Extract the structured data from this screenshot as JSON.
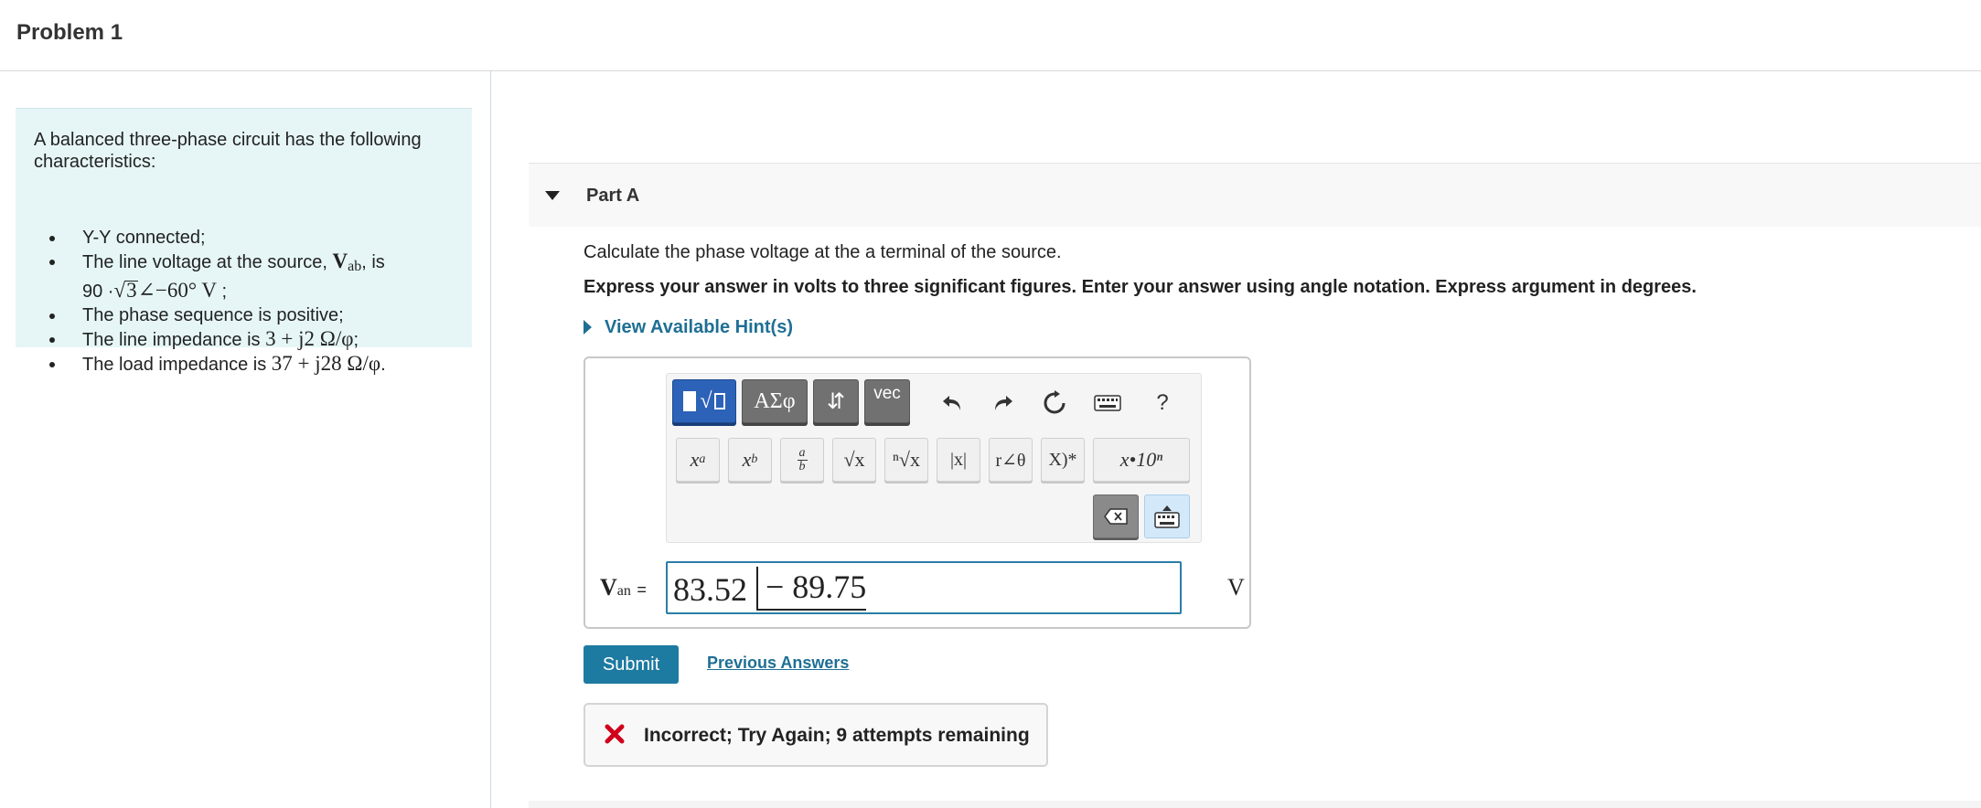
{
  "problem": {
    "title": "Problem 1"
  },
  "intro": {
    "text": "A balanced three-phase circuit has the following characteristics:",
    "items": {
      "wye": "Y-Y connected;",
      "line_voltage_prefix": "The line voltage at the source, ",
      "line_voltage_symbol": "V",
      "line_voltage_sub": "ab",
      "line_voltage_mid": ", is",
      "line_voltage_value_a": "90 ·",
      "line_voltage_sqrt": "3",
      "line_voltage_value_b": "∠−60° V",
      "line_voltage_end": ";",
      "sequence": "The phase sequence is positive;",
      "line_impedance_prefix": "The line impedance is ",
      "line_impedance_value": "3 + j2 Ω/φ",
      "line_impedance_end": ";",
      "load_impedance_prefix": "The load impedance is ",
      "load_impedance_value": "37 + j28 Ω/φ",
      "load_impedance_end": "."
    }
  },
  "part": {
    "label": "Part A",
    "question": "Calculate the phase voltage at the a terminal of the source.",
    "instruction": "Express your answer in volts to three significant figures. Enter your answer using angle notation. Express argument in degrees.",
    "hint_link": "View Available Hint(s)"
  },
  "toolbar": {
    "templates_label": "√",
    "greek_label": "ΑΣφ",
    "arrows_label": "⇵",
    "vec_label": "vec",
    "help_label": "?",
    "superscript_label": "x",
    "superscript_exp": "a",
    "subscript_label": "x",
    "subscript_sub": "b",
    "fraction_num": "a",
    "fraction_den": "b",
    "sqrt_label": "√x",
    "nthroot_label": "ⁿ√x",
    "abs_label": "|x|",
    "angle_label": "r∠θ",
    "conj_label": "X)*",
    "sci_label": "x•10ⁿ"
  },
  "answer": {
    "label_symbol": "V",
    "label_sub": "an",
    "label_eq": "=",
    "magnitude": "83.52",
    "argument": "− 89.75",
    "unit": "V"
  },
  "actions": {
    "submit": "Submit",
    "previous": "Previous Answers"
  },
  "feedback": {
    "message": "Incorrect; Try Again; 9 attempts remaining",
    "status_color": "#d0021b"
  },
  "colors": {
    "accent": "#1d7aa1",
    "intro_bg": "#e6f6f7",
    "toolbar_dark": "#717171",
    "toolbar_blue": "#2c62b8"
  }
}
